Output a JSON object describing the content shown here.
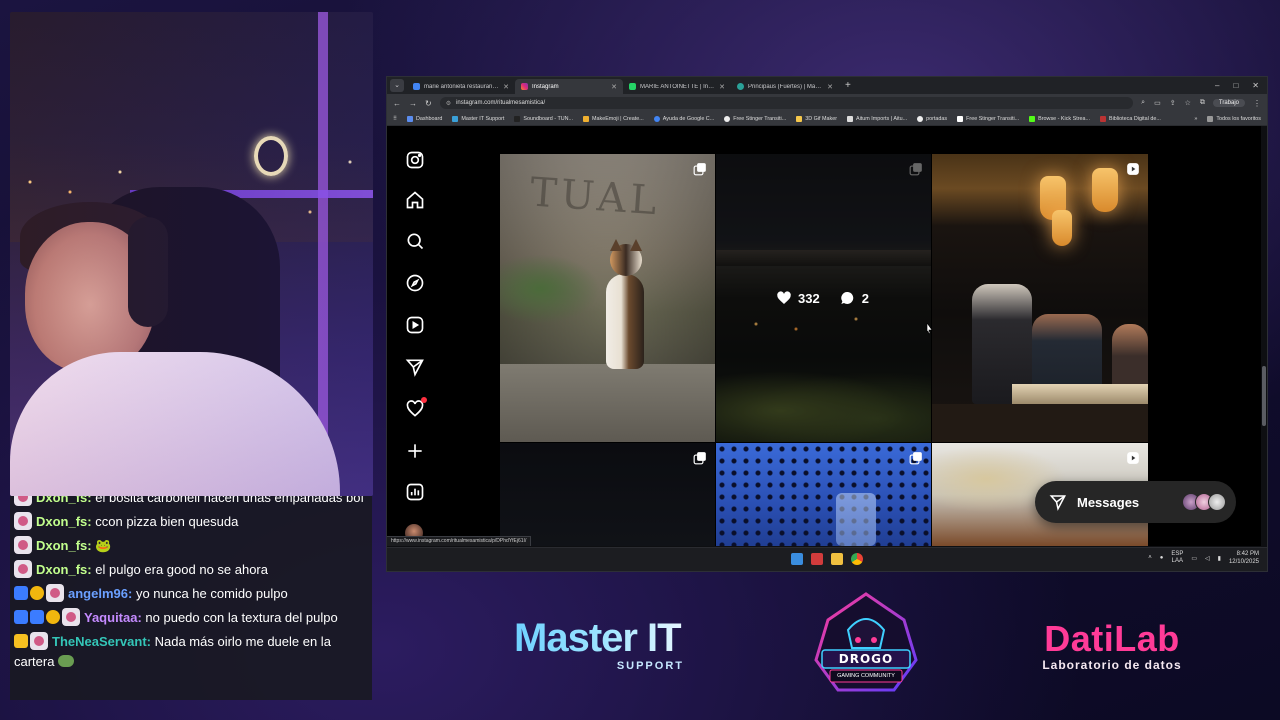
{
  "colors": {
    "accent": "#ff3b97",
    "brand_master": "#6fd1ff",
    "instagram_bg": "#000000",
    "notification_dot": "#ff3040"
  },
  "chat": {
    "messages": [
      {
        "user": "Dxon_fs:",
        "text": "el bosita carbonell hacen unas empanadas bof",
        "cut": true
      },
      {
        "user": "Dxon_fs:",
        "text": "ccon pizza bien quesuda"
      },
      {
        "user": "Dxon_fs:",
        "text": "🐸"
      },
      {
        "user": "Dxon_fs:",
        "text": "el pulgo era good no se ahora"
      },
      {
        "user": "angelm96:",
        "text": "yo nunca he comido pulpo"
      },
      {
        "user": "Yaquitaa:",
        "text": "no puedo con la textura del pulpo"
      },
      {
        "user": "TheNeaServant:",
        "text": "Nada más oirlo me duele en la cartera"
      }
    ]
  },
  "browser": {
    "tabs": [
      {
        "label": "marie antonieta restaurante - Bu",
        "icon": "google-icon"
      },
      {
        "label": "Instagram",
        "icon": "instagram-icon",
        "active": true
      },
      {
        "label": "MARIE ANTOINETTE | Instagram",
        "icon": "whatsapp-icon"
      },
      {
        "label": "Principaus (Fuertes) | Marie Ant",
        "icon": "globe-icon"
      }
    ],
    "new_tab": "+",
    "window_controls": [
      "–",
      "□",
      "✕"
    ],
    "url": "instagram.com/ritualmesamistica/",
    "profile_label": "Trabajo",
    "bookmarks": [
      "Dashboard",
      "Master IT Support",
      "Soundboard - TUN...",
      "MakeEmoji | Create...",
      "Ayuda de Google C...",
      "Free Stinger Transiti...",
      "3D Gif Maker",
      "Aitum Imports | Aitu...",
      "portadas",
      "Free Stinger Transiti...",
      "Browse - Kick Strea...",
      "Biblioteca Digital de..."
    ],
    "bookmarks_right": "Todos los favoritos",
    "status_url": "https://www.instagram.com/ritualmesamistica/p/DPhdYfEj61I/"
  },
  "instagram": {
    "nav_icons": [
      "instagram-logo-icon",
      "home-icon",
      "search-icon",
      "explore-icon",
      "reels-icon",
      "messages-icon",
      "notifications-icon",
      "create-icon",
      "dashboard-icon",
      "profile-avatar"
    ],
    "hovered_post": {
      "likes": "332",
      "comments": "2"
    },
    "messages_button": "Messages"
  },
  "taskbar": {
    "lang_top": "ESP",
    "lang_bottom": "LAA",
    "time": "8:42 PM",
    "date": "12/10/2025"
  },
  "sponsors": {
    "master_title": "Master IT",
    "master_sub": "SUPPORT",
    "drogo_text": "DROGO",
    "drogo_sub": "GAMING COMMUNITY",
    "dati_title": "DatiLab",
    "dati_sub": "Laboratorio de datos"
  }
}
